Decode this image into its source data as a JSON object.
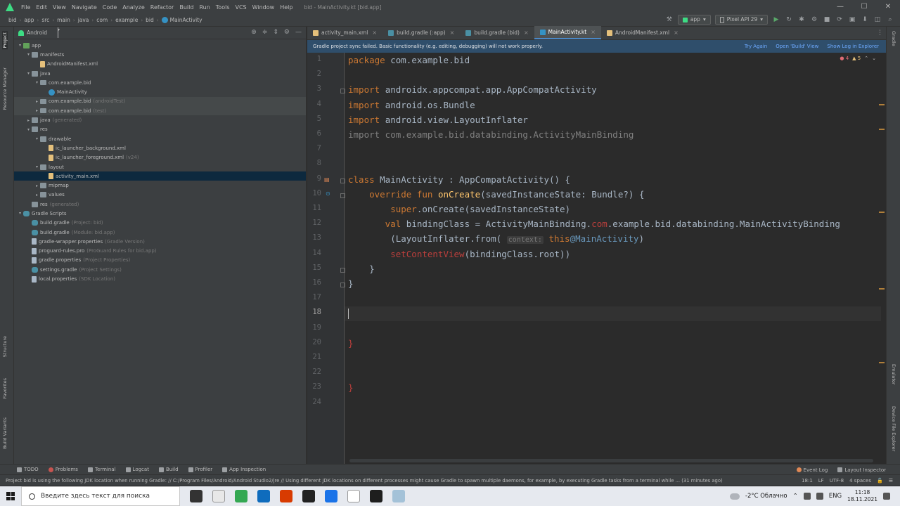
{
  "menu": {
    "items": [
      "File",
      "Edit",
      "View",
      "Navigate",
      "Code",
      "Analyze",
      "Refactor",
      "Build",
      "Run",
      "Tools",
      "VCS",
      "Window",
      "Help"
    ],
    "window_title": "bid - MainActivity.kt [bid.app]",
    "minimize": "—",
    "maximize": "☐",
    "close": "✕"
  },
  "breadcrumb": [
    "bid",
    "app",
    "src",
    "main",
    "java",
    "com",
    "example",
    "bid",
    "MainActivity"
  ],
  "toolbar": {
    "run_config": "app",
    "device": "Pixel API 29"
  },
  "left_strip": [
    "Project",
    "Resource Manager",
    "Structure",
    "Favorites",
    "Build Variants"
  ],
  "right_strip": [
    "Gradle",
    "Emulator",
    "Device File Explorer"
  ],
  "project_panel": {
    "view": "Android",
    "tree": [
      {
        "depth": 0,
        "arrow": "▾",
        "icon": "folder-green",
        "label": "app",
        "hint": ""
      },
      {
        "depth": 1,
        "arrow": "▾",
        "icon": "folder",
        "label": "manifests",
        "hint": ""
      },
      {
        "depth": 2,
        "arrow": "",
        "icon": "xml",
        "label": "AndroidManifest.xml",
        "hint": ""
      },
      {
        "depth": 1,
        "arrow": "▾",
        "icon": "folder",
        "label": "java",
        "hint": ""
      },
      {
        "depth": 2,
        "arrow": "▾",
        "icon": "pkg",
        "label": "com.example.bid",
        "hint": ""
      },
      {
        "depth": 3,
        "arrow": "",
        "icon": "kt",
        "label": "MainActivity",
        "hint": ""
      },
      {
        "depth": 2,
        "arrow": "▸",
        "icon": "pkg",
        "label": "com.example.bid",
        "hint": "(androidTest)",
        "sel": "light"
      },
      {
        "depth": 2,
        "arrow": "▸",
        "icon": "pkg",
        "label": "com.example.bid",
        "hint": "(test)",
        "sel": "light"
      },
      {
        "depth": 1,
        "arrow": "▸",
        "icon": "folder",
        "label": "java",
        "hint": "(generated)"
      },
      {
        "depth": 1,
        "arrow": "▾",
        "icon": "folder",
        "label": "res",
        "hint": ""
      },
      {
        "depth": 2,
        "arrow": "▾",
        "icon": "folder",
        "label": "drawable",
        "hint": ""
      },
      {
        "depth": 3,
        "arrow": "",
        "icon": "xml",
        "label": "ic_launcher_background.xml",
        "hint": ""
      },
      {
        "depth": 3,
        "arrow": "",
        "icon": "xml",
        "label": "ic_launcher_foreground.xml",
        "hint": "(v24)"
      },
      {
        "depth": 2,
        "arrow": "▾",
        "icon": "folder",
        "label": "layout",
        "hint": ""
      },
      {
        "depth": 3,
        "arrow": "",
        "icon": "xml",
        "label": "activity_main.xml",
        "hint": "",
        "sel": "blue"
      },
      {
        "depth": 2,
        "arrow": "▸",
        "icon": "folder",
        "label": "mipmap",
        "hint": ""
      },
      {
        "depth": 2,
        "arrow": "▸",
        "icon": "folder",
        "label": "values",
        "hint": ""
      },
      {
        "depth": 1,
        "arrow": "",
        "icon": "folder",
        "label": "res",
        "hint": "(generated)"
      },
      {
        "depth": 0,
        "arrow": "▾",
        "icon": "gradle",
        "label": "Gradle Scripts",
        "hint": ""
      },
      {
        "depth": 1,
        "arrow": "",
        "icon": "gradle",
        "label": "build.gradle",
        "hint": "(Project: bid)"
      },
      {
        "depth": 1,
        "arrow": "",
        "icon": "gradle",
        "label": "build.gradle",
        "hint": "(Module: bid.app)"
      },
      {
        "depth": 1,
        "arrow": "",
        "icon": "file",
        "label": "gradle-wrapper.properties",
        "hint": "(Gradle Version)"
      },
      {
        "depth": 1,
        "arrow": "",
        "icon": "file",
        "label": "proguard-rules.pro",
        "hint": "(ProGuard Rules for bid.app)"
      },
      {
        "depth": 1,
        "arrow": "",
        "icon": "file",
        "label": "gradle.properties",
        "hint": "(Project Properties)"
      },
      {
        "depth": 1,
        "arrow": "",
        "icon": "gradle",
        "label": "settings.gradle",
        "hint": "(Project Settings)"
      },
      {
        "depth": 1,
        "arrow": "",
        "icon": "file",
        "label": "local.properties",
        "hint": "(SDK Location)"
      }
    ]
  },
  "tabs": [
    {
      "label": "activity_main.xml",
      "icon": "#e5c07b",
      "active": false
    },
    {
      "label": "build.gradle (:app)",
      "icon": "#4a90a4",
      "active": false
    },
    {
      "label": "build.gradle (bid)",
      "icon": "#4a90a4",
      "active": false
    },
    {
      "label": "MainActivity.kt",
      "icon": "#3592c4",
      "active": true
    },
    {
      "label": "AndroidManifest.xml",
      "icon": "#e5c07b",
      "active": false
    }
  ],
  "notice": {
    "message": "Gradle project sync failed. Basic functionality (e.g. editing, debugging) will not work properly.",
    "links": [
      "Try Again",
      "Open 'Build' View",
      "Show Log in Explorer"
    ]
  },
  "editor": {
    "errors": "4",
    "warnings": "5",
    "current_line": 18,
    "line_numbers": [
      "1",
      "2",
      "3",
      "4",
      "5",
      "6",
      "7",
      "8",
      "9",
      "10",
      "11",
      "12",
      "13",
      "14",
      "15",
      "16",
      "17",
      "18",
      "19",
      "20",
      "21",
      "22",
      "23",
      "24"
    ],
    "lines": [
      [
        {
          "t": "package ",
          "c": "kw"
        },
        {
          "t": "com.example.bid",
          "c": ""
        }
      ],
      [],
      [
        {
          "t": "import ",
          "c": "kw"
        },
        {
          "t": "androidx.appcompat.app.AppCompatActivity",
          "c": ""
        }
      ],
      [
        {
          "t": "import ",
          "c": "kw"
        },
        {
          "t": "android.os.Bundle",
          "c": ""
        }
      ],
      [
        {
          "t": "import ",
          "c": "kw"
        },
        {
          "t": "android.view.LayoutInflater",
          "c": ""
        }
      ],
      [
        {
          "t": "import com.example.bid.databinding.ActivityMainBinding",
          "c": "gray"
        }
      ],
      [],
      [],
      [
        {
          "t": "class ",
          "c": "kw"
        },
        {
          "t": "MainActivity : AppCompatActivity() {",
          "c": ""
        }
      ],
      [
        {
          "t": "    override fun ",
          "c": "kw"
        },
        {
          "t": "onCreate",
          "c": "fn"
        },
        {
          "t": "(savedInstanceState: Bundle?) {",
          "c": ""
        }
      ],
      [
        {
          "t": "        super",
          "c": "kw"
        },
        {
          "t": ".onCreate(savedInstanceState)",
          "c": ""
        }
      ],
      [
        {
          "t": "       val ",
          "c": "kw"
        },
        {
          "t": "bindingClass = ActivityMainBinding.",
          "c": ""
        },
        {
          "t": "com",
          "c": "red"
        },
        {
          "t": ".example.bid.databinding.MainActivityBinding",
          "c": ""
        }
      ],
      [
        {
          "t": "        (LayoutInflater.from( ",
          "c": ""
        },
        {
          "t": "context:",
          "c": "hint-box"
        },
        {
          "t": " this",
          "c": "kw"
        },
        {
          "t": "@MainActivity",
          "c": "label-at"
        },
        {
          "t": ")",
          "c": ""
        }
      ],
      [
        {
          "t": "        setContentView",
          "c": "red"
        },
        {
          "t": "(bindingClass.root))",
          "c": ""
        }
      ],
      [
        {
          "t": "    }",
          "c": ""
        }
      ],
      [
        {
          "t": "}",
          "c": ""
        }
      ],
      [],
      [],
      [],
      [
        {
          "t": "}",
          "c": "err-mark"
        }
      ],
      [],
      [],
      [
        {
          "t": "}",
          "c": "err-mark"
        }
      ],
      []
    ]
  },
  "bottom_tools": [
    {
      "label": "TODO",
      "icon": ""
    },
    {
      "label": "Problems",
      "icon": "red"
    },
    {
      "label": "Terminal",
      "icon": ""
    },
    {
      "label": "Logcat",
      "icon": ""
    },
    {
      "label": "Build",
      "icon": ""
    },
    {
      "label": "Profiler",
      "icon": ""
    },
    {
      "label": "App Inspection",
      "icon": ""
    }
  ],
  "bottom_right_tools": [
    "Event Log",
    "Layout Inspector"
  ],
  "status": {
    "message": "Project bid is using the following JDK location when running Gradle: // C:/Program Files/Android/Android Studio2/jre // Using different JDK locations on different processes might cause Gradle to spawn multiple daemons, for example, by executing Gradle tasks from a terminal while ... (31 minutes ago)",
    "position": "18:1",
    "line_sep": "LF",
    "encoding": "UTF-8",
    "indent": "4 spaces"
  },
  "taskbar": {
    "search_placeholder": "Введите здесь текст для поиска",
    "weather": "-2°C  Облачно",
    "lang": "ENG",
    "time": "11:18",
    "date": "18.11.2021",
    "app_colors": [
      "#333333",
      "#e8e8e8",
      "#34a853",
      "#0f6cbd",
      "#d83b01",
      "#222222",
      "#1a73e8",
      "#ffffff",
      "#1e1e1e",
      "#a4c2d8"
    ]
  }
}
